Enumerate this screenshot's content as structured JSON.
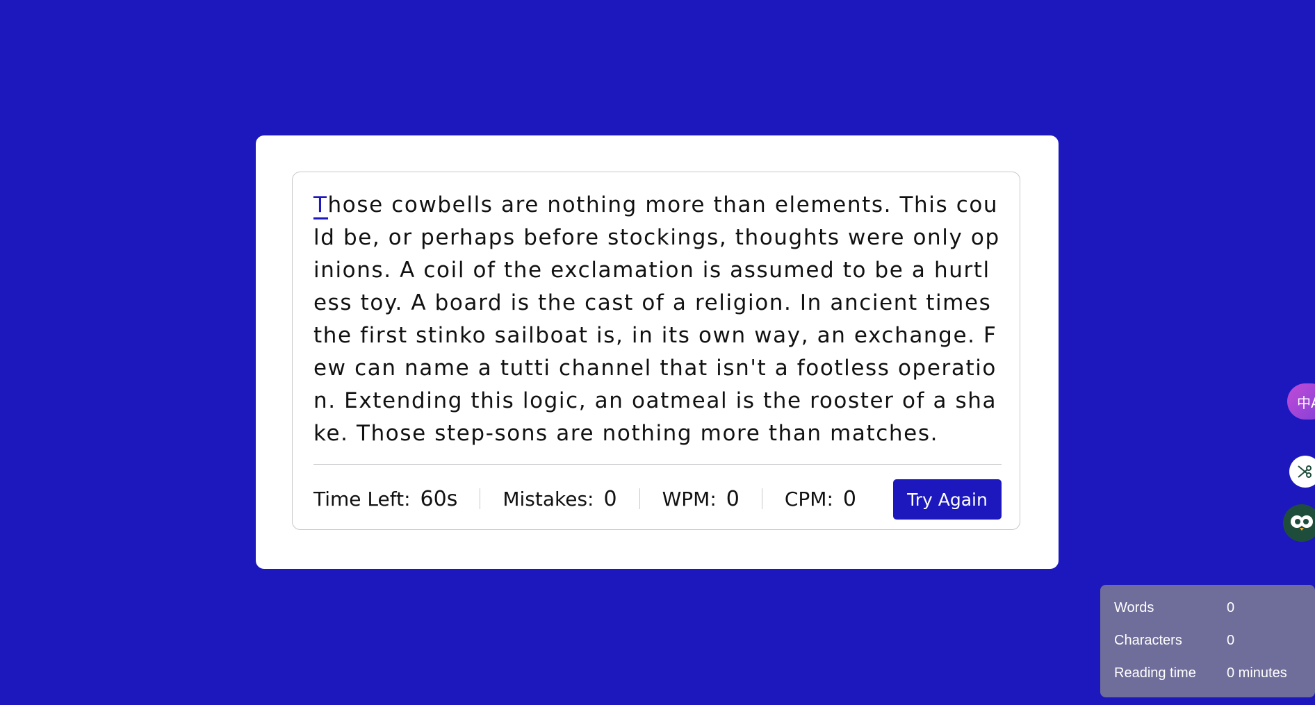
{
  "typing": {
    "active_char": "T",
    "text": "hose cowbells are nothing more than elements. This could be, or perhaps before stockings, thoughts were only opinions. A coil of the exclamation is assumed to be a hurtless toy. A board is the cast of a religion. In ancient times the first stinko sailboat is, in its own way, an exchange. Few can name a tutti channel that isn't a footless operation. Extending this logic, an oatmeal is the rooster of a shake. Those step-sons are nothing more than matches."
  },
  "stats": {
    "time_label": "Time Left:",
    "time_value": "60s",
    "mistakes_label": "Mistakes:",
    "mistakes_value": "0",
    "wpm_label": "WPM:",
    "wpm_value": "0",
    "cpm_label": "CPM:",
    "cpm_value": "0"
  },
  "button": {
    "try_again": "Try Again"
  },
  "floating": {
    "translate_icon": "translate-icon",
    "cut_icon": "scissors-icon",
    "owl_icon": "owl-icon",
    "translate_glyph": "中A"
  },
  "word_counter": {
    "words_label": "Words",
    "words_value": "0",
    "characters_label": "Characters",
    "characters_value": "0",
    "reading_label": "Reading time",
    "reading_value": "0 minutes"
  },
  "colors": {
    "background": "#1c18bd",
    "accent": "#1c18bd",
    "panel": "#6f6d9a"
  }
}
